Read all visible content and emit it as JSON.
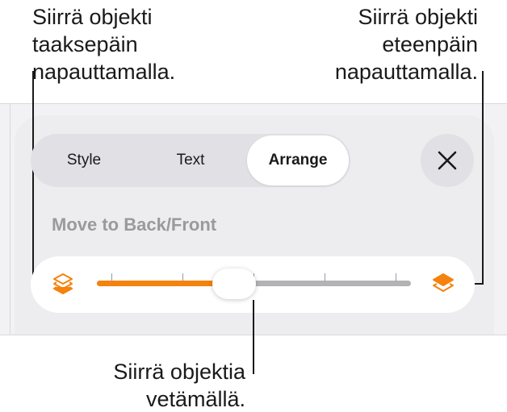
{
  "callouts": {
    "move_back": "Siirrä objekti\ntaaksepäin\nnapauttamalla.",
    "move_front": "Siirrä objekti\neteenpäin\nnapauttamalla.",
    "drag": "Siirrä objektia\nvetämällä."
  },
  "tabs": [
    {
      "label": "Style",
      "selected": false
    },
    {
      "label": "Text",
      "selected": false
    },
    {
      "label": "Arrange",
      "selected": true
    }
  ],
  "close_icon": "close-icon",
  "section": {
    "label": "Move to Back/Front"
  },
  "slider": {
    "position_fraction": 0.5,
    "tick_count": 5,
    "back_icon": "layers-back-icon",
    "front_icon": "layers-front-icon"
  },
  "colors": {
    "accent": "#f5820d",
    "track": "#b3b3b6",
    "panel": "#ededf0"
  }
}
